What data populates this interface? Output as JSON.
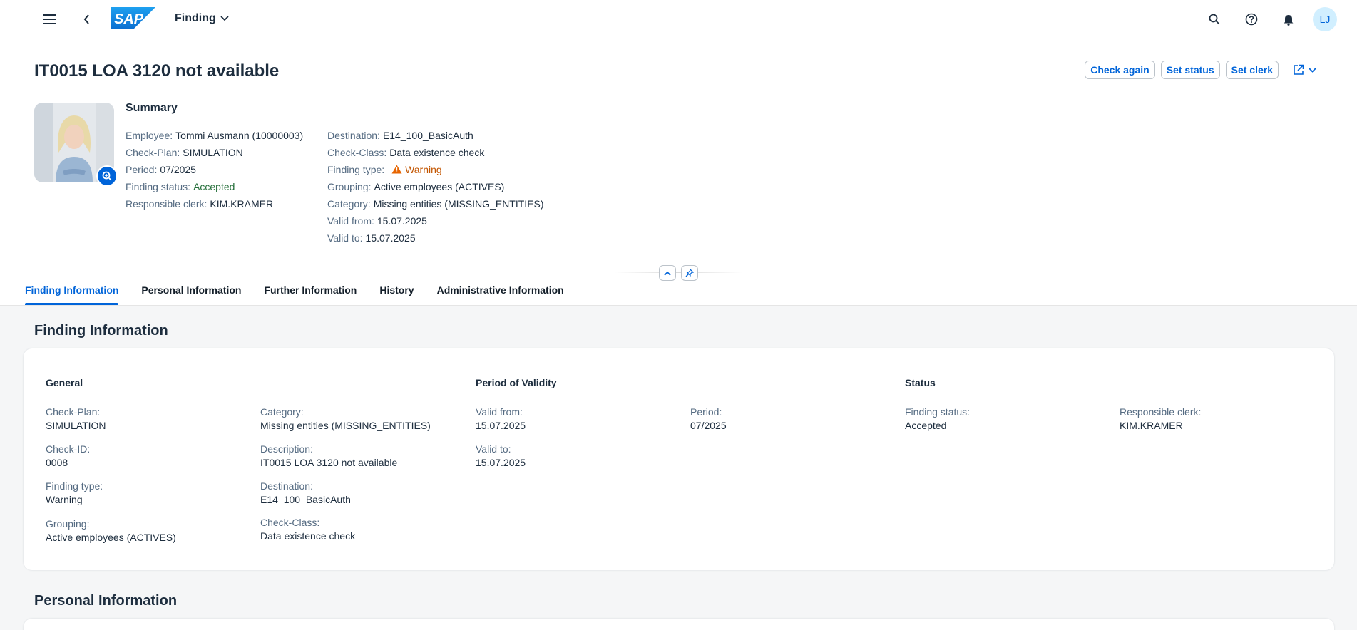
{
  "shell": {
    "app_title": "Finding",
    "avatar_initials": "LJ",
    "logo_text": "SAP"
  },
  "header": {
    "title": "IT0015 LOA 3120 not available",
    "actions": [
      "Check again",
      "Set status",
      "Set clerk"
    ],
    "summary_title": "Summary",
    "left_fields": [
      {
        "label": "Employee:",
        "value": "Tommi Ausmann (10000003)"
      },
      {
        "label": "Check-Plan:",
        "value": "SIMULATION"
      },
      {
        "label": "Period:",
        "value": "07/2025"
      },
      {
        "label": "Finding status:",
        "value": "Accepted"
      },
      {
        "label": "Responsible clerk:",
        "value": "KIM.KRAMER"
      }
    ],
    "right_fields": [
      {
        "label": "Destination:",
        "value": "E14_100_BasicAuth"
      },
      {
        "label": "Check-Class:",
        "value": "Data existence check"
      },
      {
        "label": "Finding type:",
        "value": "Warning"
      },
      {
        "label": "Grouping:",
        "value": "Active employees (ACTIVES)"
      },
      {
        "label": "Category:",
        "value": "Missing entities (MISSING_ENTITIES)"
      },
      {
        "label": "Valid from:",
        "value": "15.07.2025"
      },
      {
        "label": "Valid to:",
        "value": "15.07.2025"
      }
    ]
  },
  "tabs": [
    "Finding Information",
    "Personal Information",
    "Further Information",
    "History",
    "Administrative Information"
  ],
  "finding_section": {
    "title": "Finding Information",
    "groups": [
      "General",
      "Period of Validity",
      "Status"
    ],
    "fields": {
      "check_plan": {
        "label": "Check-Plan:",
        "value": "SIMULATION"
      },
      "check_id": {
        "label": "Check-ID:",
        "value": "0008"
      },
      "finding_type": {
        "label": "Finding type:",
        "value": "Warning"
      },
      "grouping": {
        "label": "Grouping:",
        "value": "Active employees (ACTIVES)"
      },
      "category": {
        "label": "Category:",
        "value": "Missing entities (MISSING_ENTITIES)"
      },
      "description": {
        "label": "Description:",
        "value": "IT0015 LOA 3120 not available"
      },
      "destination": {
        "label": "Destination:",
        "value": "E14_100_BasicAuth"
      },
      "check_class": {
        "label": "Check-Class:",
        "value": "Data existence check"
      },
      "valid_from": {
        "label": "Valid from:",
        "value": "15.07.2025"
      },
      "valid_to": {
        "label": "Valid to:",
        "value": "15.07.2025"
      },
      "period": {
        "label": "Period:",
        "value": "07/2025"
      },
      "finding_status": {
        "label": "Finding status:",
        "value": "Accepted"
      },
      "responsible_clerk": {
        "label": "Responsible clerk:",
        "value": "KIM.KRAMER"
      }
    }
  },
  "personal_section": {
    "title": "Personal Information"
  },
  "colors": {
    "accent": "#0064d9",
    "success": "#256f3a",
    "warning": "#c35500",
    "label": "#556b82"
  }
}
